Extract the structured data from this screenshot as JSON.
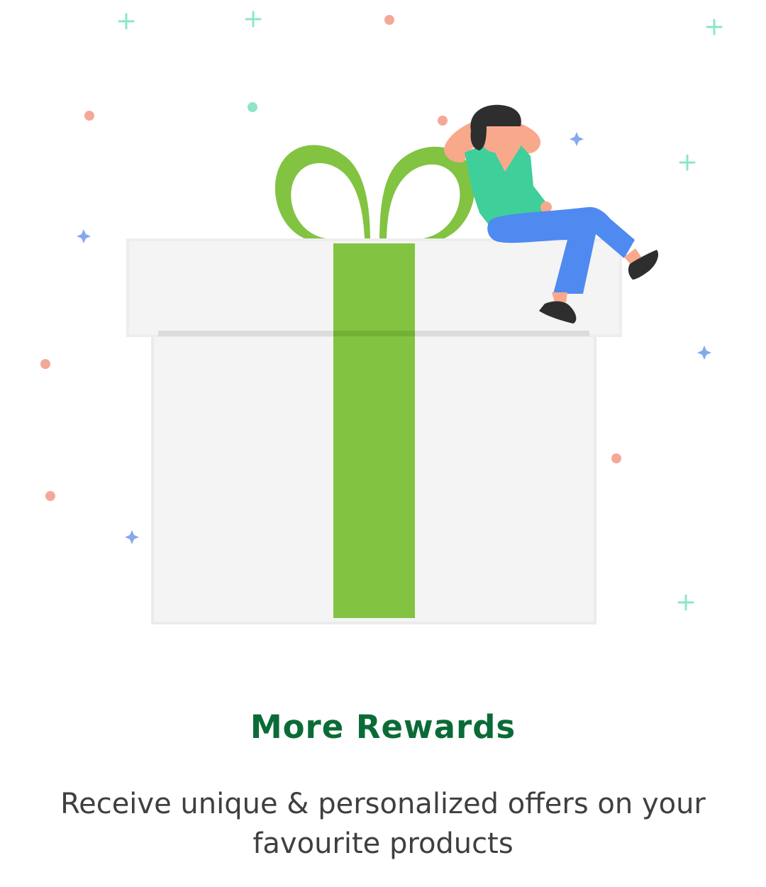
{
  "onboarding": {
    "title": "More Rewards",
    "description": "Receive unique & personalized offers on your favourite products"
  },
  "illustration": {
    "icon": "gift-box-with-person-illustration",
    "colors": {
      "ribbon": "#82c341",
      "box": "#f4f4f5",
      "shirt": "#3ecf9b",
      "pants": "#4e8af0",
      "skin": "#f8a98c",
      "hair": "#2e2e2e",
      "confetti_pink": "#f4a898",
      "confetti_mint": "#8ee6c4",
      "confetti_blue": "#86a8ef"
    }
  },
  "colors": {
    "title": "#0b6b36",
    "description": "#3f3f3f"
  }
}
